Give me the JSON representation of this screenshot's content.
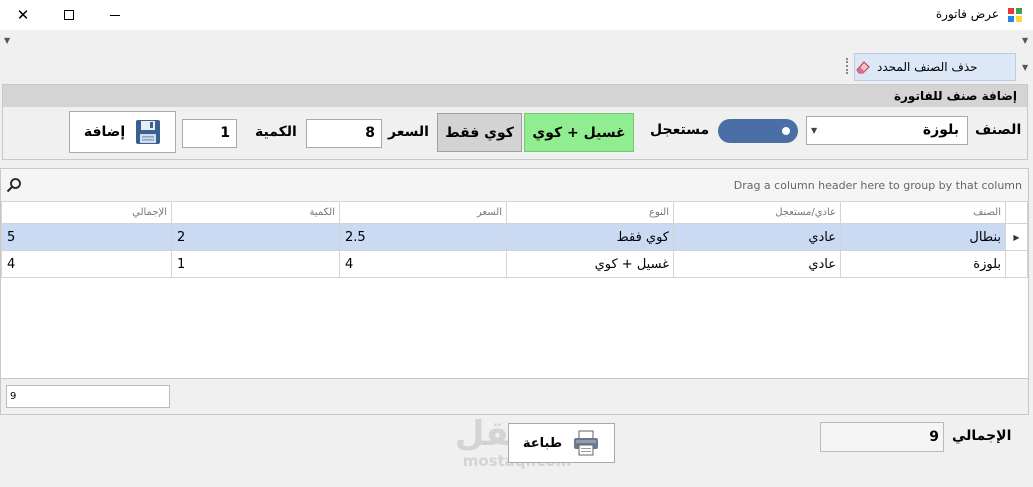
{
  "window": {
    "title": "عرض فاتورة",
    "close_glyph": "✕"
  },
  "toolbar": {
    "delete_label": "حذف الصنف المحدد"
  },
  "add_panel": {
    "header": "إضافة صنف للفاتورة",
    "item_label": "الصنف",
    "item_value": "بلوزة",
    "urgent_label": "مستعجل",
    "wash_iron_label": "غسيل + كوي",
    "iron_only_label": "كوي فقط",
    "price_label": "السعر",
    "price_value": "8",
    "quantity_label": "الكمية",
    "quantity_value": "1",
    "add_label": "إضافة"
  },
  "grid": {
    "group_hint": "Drag a column header here to group by that column",
    "columns": [
      "الصنف",
      "عادي/مستعجل",
      "النوع",
      "السعر",
      "الكمية",
      "الإجمالي"
    ],
    "rows": [
      [
        "بنطال",
        "عادي",
        "كوي فقط",
        "2.5",
        "2",
        "5"
      ],
      [
        "بلوزة",
        "عادي",
        "غسيل + كوي",
        "4",
        "1",
        "4"
      ]
    ],
    "footer_value": "9"
  },
  "bottom": {
    "print_label": "طباعة",
    "total_label": "الإجمالي",
    "total_value": "9"
  },
  "watermark": {
    "text_ar": "مستقل",
    "text_en": "mostaql.com"
  },
  "colors": {
    "toggle": "#4a6fa5",
    "wash_button": "#90ee90",
    "selected_row": "#c9daf2"
  }
}
